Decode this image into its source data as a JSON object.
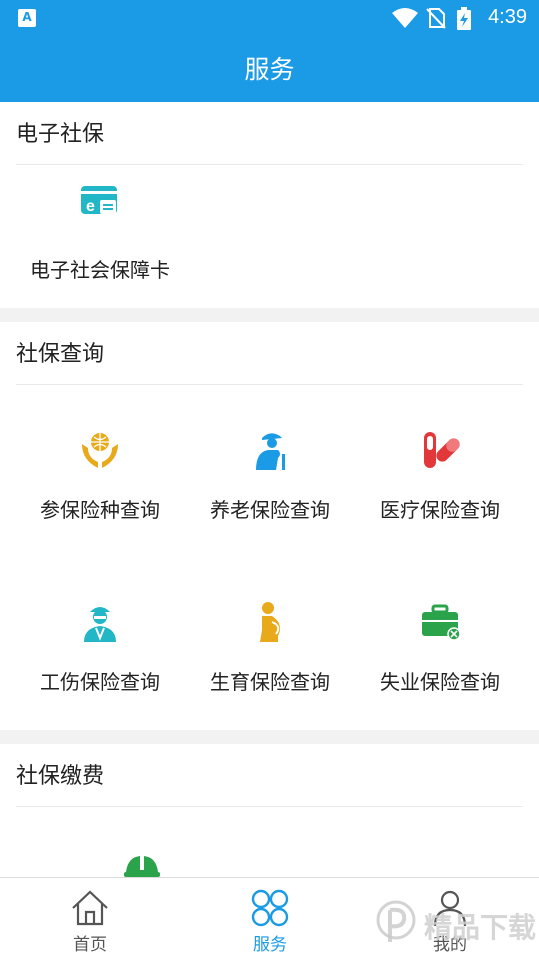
{
  "status": {
    "a_icon": "A",
    "time": "4:39"
  },
  "title": "服务",
  "sections": {
    "electronic": {
      "title": "电子社保",
      "items": [
        {
          "label": "电子社会保障卡",
          "icon": "ecard-icon",
          "color": "#21b7c7"
        }
      ]
    },
    "query": {
      "title": "社保查询",
      "items": [
        {
          "label": "参保险种查询",
          "icon": "globe-hands-icon",
          "color": "#e8a91b"
        },
        {
          "label": "养老保险查询",
          "icon": "elderly-icon",
          "color": "#1b9be6"
        },
        {
          "label": "医疗保险查询",
          "icon": "pill-icon",
          "color": "#e2383a"
        },
        {
          "label": "工伤保险查询",
          "icon": "worker-icon",
          "color": "#21b7c7"
        },
        {
          "label": "生育保险查询",
          "icon": "pregnant-icon",
          "color": "#e8a91b"
        },
        {
          "label": "失业保险查询",
          "icon": "briefcase-x-icon",
          "color": "#2aa34a"
        }
      ]
    },
    "payment": {
      "title": "社保缴费",
      "items": [
        {
          "icon": "helmet-icon",
          "color": "#2aa34a"
        }
      ]
    }
  },
  "bottom_nav": [
    {
      "label": "首页",
      "icon": "home-icon",
      "active": false
    },
    {
      "label": "服务",
      "icon": "clover-icon",
      "active": true
    },
    {
      "label": "我的",
      "icon": "person-icon",
      "active": false
    }
  ],
  "watermark": {
    "text": "精品下载"
  },
  "colors": {
    "primary": "#1b9be6",
    "nav_inactive": "#555555"
  }
}
